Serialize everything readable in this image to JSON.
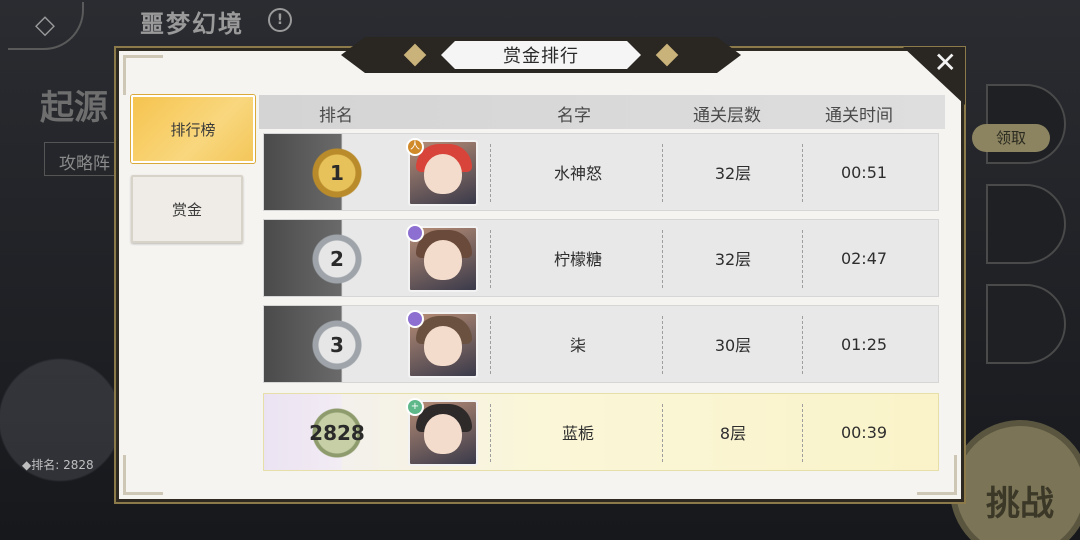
{
  "background": {
    "back_icon": "back-arrow-icon",
    "title": "噩梦幻境",
    "info_icon": "!",
    "origin_label": "起源",
    "strategy_button": "攻略阵",
    "rank_footer": "◆排名: 2828",
    "claim_button": "领取",
    "challenge_button": "挑战"
  },
  "modal": {
    "title": "赏金排行",
    "close_icon": "✕",
    "tabs": [
      {
        "label": "排行榜",
        "active": true
      },
      {
        "label": "赏金",
        "active": false
      }
    ],
    "headers": {
      "rank": "排名",
      "name": "名字",
      "floors": "通关层数",
      "time": "通关时间"
    },
    "rows": [
      {
        "rank": "1",
        "name": "水神怒",
        "floors": "32层",
        "time": "00:51",
        "badge": "gold",
        "hair": "#d8443a",
        "tag": "#d08a2a",
        "tag_icon": "人"
      },
      {
        "rank": "2",
        "name": "柠檬糖",
        "floors": "32层",
        "time": "02:47",
        "badge": "silver",
        "hair": "#6a4a3a",
        "tag": "#8c6fd0",
        "tag_icon": ""
      },
      {
        "rank": "3",
        "name": "柒",
        "floors": "30层",
        "time": "01:25",
        "badge": "silver",
        "hair": "#6b5240",
        "tag": "#8c6fd0",
        "tag_icon": ""
      },
      {
        "rank": "2828",
        "name": "蓝栀",
        "floors": "8层",
        "time": "00:39",
        "badge": "green",
        "hair": "#2f2a2a",
        "tag": "#5fb88a",
        "tag_icon": "+"
      }
    ]
  }
}
